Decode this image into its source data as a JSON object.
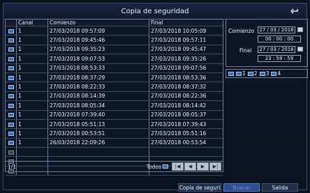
{
  "title": "Copia de seguridad",
  "table": {
    "headers": [
      "",
      "Canal",
      "Comienzo",
      "Final"
    ],
    "rows": [
      {
        "canal": "1",
        "comienzo": "27/03/2018 09:57:09",
        "final": "27/03/2018 10:05:09"
      },
      {
        "canal": "1",
        "comienzo": "27/03/2018 09:45:46",
        "final": "27/03/2018 09:57:11"
      },
      {
        "canal": "1",
        "comienzo": "27/03/2018 09:35:23",
        "final": "27/03/2018 09:45:47"
      },
      {
        "canal": "1",
        "comienzo": "27/03/2018 09:07:53",
        "final": "27/03/2018 09:35:26"
      },
      {
        "canal": "1",
        "comienzo": "27/03/2018 08:53:33",
        "final": "27/03/2018 09:07:56"
      },
      {
        "canal": "1",
        "comienzo": "27/03/2018 08:37:29",
        "final": "27/03/2018 08:53:36"
      },
      {
        "canal": "1",
        "comienzo": "27/03/2018 08:22:33",
        "final": "27/03/2018 08:37:32"
      },
      {
        "canal": "1",
        "comienzo": "27/03/2018 08:14:39",
        "final": "27/03/2018 08:22:36"
      },
      {
        "canal": "1",
        "comienzo": "27/03/2018 08:05:34",
        "final": "27/03/2018 08:14:42"
      },
      {
        "canal": "1",
        "comienzo": "27/03/2018 07:39:40",
        "final": "27/03/2018 08:05:37"
      },
      {
        "canal": "1",
        "comienzo": "27/03/2018 05:51:13",
        "final": "27/03/2018 07:39:43"
      },
      {
        "canal": "1",
        "comienzo": "27/03/2018 00:53:51",
        "final": "27/03/2018 05:51:16"
      },
      {
        "canal": "1",
        "comienzo": "26/03/2018 22:09:26",
        "final": "27/03/2018 00:53:54"
      }
    ],
    "empty_rows": 3,
    "page": "1/1",
    "todos_label": "Todos"
  },
  "range": {
    "start_label": "Comienzo",
    "start_date": "27 / 03 / 2018",
    "start_time": "00 : 00 : 00",
    "end_label": "Final",
    "end_date": "27 / 03 / 2018",
    "end_time": "23 : 59 : 59"
  },
  "channels": [
    "1",
    "2",
    "3",
    "4"
  ],
  "buttons": {
    "backup": "Copia de seguri",
    "search": "Buscar",
    "exit": "Salida"
  },
  "colors": {
    "background": "#0b1220",
    "checkbox": "#3b6fb5",
    "active_button": "#2a4f93"
  }
}
